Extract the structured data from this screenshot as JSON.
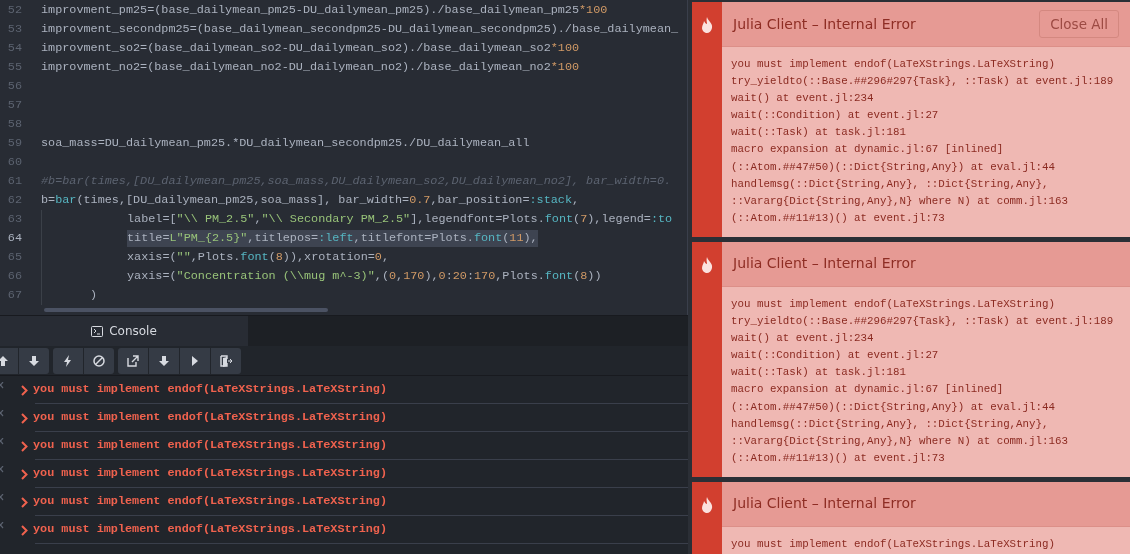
{
  "editor": {
    "lines": [
      {
        "number": "52",
        "tokens": [
          {
            "text": "improvment_pm25=(base_dailymean_pm25-DU_dailymean_pm25)./base_dailymean_pm25",
            "kind": "plain"
          },
          {
            "text": "*100",
            "kind": "number"
          }
        ]
      },
      {
        "number": "53",
        "tokens": [
          {
            "text": "improvment_secondpm25=(base_dailymean_secondpm25-DU_dailymean_secondpm25)./base_dailymean_",
            "kind": "plain"
          }
        ]
      },
      {
        "number": "54",
        "tokens": [
          {
            "text": "improvment_so2=(base_dailymean_so2-DU_dailymean_so2)./base_dailymean_so2",
            "kind": "plain"
          },
          {
            "text": "*100",
            "kind": "number"
          }
        ]
      },
      {
        "number": "55",
        "tokens": [
          {
            "text": "improvment_no2=(base_dailymean_no2-DU_dailymean_no2)./base_dailymean_no2",
            "kind": "plain"
          },
          {
            "text": "*100",
            "kind": "number"
          }
        ]
      },
      {
        "number": "56"
      },
      {
        "number": "57"
      },
      {
        "number": "58"
      },
      {
        "number": "59",
        "tokens": [
          {
            "text": "soa_mass=DU_dailymean_pm25.*DU_dailymean_secondpm25./DU_dailymean_all",
            "kind": "plain"
          }
        ]
      },
      {
        "number": "60"
      },
      {
        "number": "61",
        "tokens": [
          {
            "text": "#b=bar(times,[DU_dailymean_pm25,soa_mass,DU_dailymean_so2,DU_dailymean_no2], bar_width=0.",
            "kind": "comment"
          }
        ]
      },
      {
        "number": "62",
        "tokens": [
          {
            "text": "b=",
            "kind": "plain"
          },
          {
            "text": "bar",
            "kind": "function"
          },
          {
            "text": "(times,[DU_dailymean_pm25,soa_mass], bar_width=",
            "kind": "plain"
          },
          {
            "text": "0.7",
            "kind": "number"
          },
          {
            "text": ",bar_position=",
            "kind": "plain"
          },
          {
            "text": ":stack",
            "kind": "function"
          },
          {
            "text": ",",
            "kind": "plain"
          }
        ]
      },
      {
        "number": "63",
        "kind": "continuation",
        "tokens": [
          {
            "text": "label=[",
            "kind": "plain"
          },
          {
            "text": "\"\\\\ PM_2.5\"",
            "kind": "string"
          },
          {
            "text": ",",
            "kind": "plain"
          },
          {
            "text": "\"\\\\ Secondary PM_2.5\"",
            "kind": "string"
          },
          {
            "text": "],legendfont=Plots.",
            "kind": "plain"
          },
          {
            "text": "font",
            "kind": "function"
          },
          {
            "text": "(",
            "kind": "plain"
          },
          {
            "text": "7",
            "kind": "number"
          },
          {
            "text": "),legend=",
            "kind": "plain"
          },
          {
            "text": ":to",
            "kind": "function"
          }
        ]
      },
      {
        "number": "64",
        "kind": "continuation",
        "selected": true,
        "tokens": [
          {
            "text": "title=",
            "kind": "plain"
          },
          {
            "text": "L\"PM_{2.5}\"",
            "kind": "string"
          },
          {
            "text": ",titlepos=",
            "kind": "plain"
          },
          {
            "text": ":left",
            "kind": "function"
          },
          {
            "text": ",titlefont=Plots.",
            "kind": "plain"
          },
          {
            "text": "font",
            "kind": "function"
          },
          {
            "text": "(",
            "kind": "plain"
          },
          {
            "text": "11",
            "kind": "number"
          },
          {
            "text": "),",
            "kind": "plain"
          }
        ]
      },
      {
        "number": "65",
        "kind": "continuation",
        "tokens": [
          {
            "text": "xaxis=(",
            "kind": "plain"
          },
          {
            "text": "\"\"",
            "kind": "string"
          },
          {
            "text": ",Plots.",
            "kind": "plain"
          },
          {
            "text": "font",
            "kind": "function"
          },
          {
            "text": "(",
            "kind": "plain"
          },
          {
            "text": "8",
            "kind": "number"
          },
          {
            "text": ")),xrotation=",
            "kind": "plain"
          },
          {
            "text": "0",
            "kind": "number"
          },
          {
            "text": ",",
            "kind": "plain"
          }
        ]
      },
      {
        "number": "66",
        "kind": "continuation",
        "tokens": [
          {
            "text": "yaxis=(",
            "kind": "plain"
          },
          {
            "text": "\"Concentration (\\\\mug m^-3)\"",
            "kind": "string"
          },
          {
            "text": ",(",
            "kind": "plain"
          },
          {
            "text": "0",
            "kind": "number"
          },
          {
            "text": ",",
            "kind": "plain"
          },
          {
            "text": "170",
            "kind": "number"
          },
          {
            "text": "),",
            "kind": "plain"
          },
          {
            "text": "0",
            "kind": "number"
          },
          {
            "text": ":",
            "kind": "plain"
          },
          {
            "text": "20",
            "kind": "number"
          },
          {
            "text": ":",
            "kind": "plain"
          },
          {
            "text": "170",
            "kind": "number"
          },
          {
            "text": ",Plots.",
            "kind": "plain"
          },
          {
            "text": "font",
            "kind": "function"
          },
          {
            "text": "(",
            "kind": "plain"
          },
          {
            "text": "8",
            "kind": "number"
          },
          {
            "text": "))",
            "kind": "plain"
          }
        ]
      },
      {
        "number": "67",
        "kind": "closing",
        "tokens": [
          {
            "text": ")",
            "kind": "plain"
          }
        ]
      }
    ]
  },
  "console": {
    "tab": {
      "label": "Console",
      "selected": true
    },
    "messages": [
      {
        "text": "you must implement endof(LaTeXStrings.LaTeXString)"
      },
      {
        "text": "you must implement endof(LaTeXStrings.LaTeXString)"
      },
      {
        "text": "you must implement endof(LaTeXStrings.LaTeXString)"
      },
      {
        "text": "you must implement endof(LaTeXStrings.LaTeXString)"
      },
      {
        "text": "you must implement endof(LaTeXStrings.LaTeXString)"
      },
      {
        "text": "you must implement endof(LaTeXStrings.LaTeXString)"
      }
    ]
  },
  "notifications": [
    {
      "title": "Julia Client – Internal Error",
      "button": "Close All",
      "lines": [
        "you must implement endof(LaTeXStrings.LaTeXString)",
        "try_yieldto(::Base.##296#297{Task}, ::Task) at event.jl:189",
        "wait() at event.jl:234",
        "wait(::Condition) at event.jl:27",
        "wait(::Task) at task.jl:181",
        "macro expansion at dynamic.jl:67 [inlined]",
        "(::Atom.##47#50)(::Dict{String,Any}) at eval.jl:44",
        "handlemsg(::Dict{String,Any}, ::Dict{String,Any},",
        "::Vararg{Dict{String,Any},N} where N) at comm.jl:163",
        "(::Atom.##11#13)() at event.jl:73"
      ]
    },
    {
      "title": "Julia Client – Internal Error",
      "lines": [
        "you must implement endof(LaTeXStrings.LaTeXString)",
        "try_yieldto(::Base.##296#297{Task}, ::Task) at event.jl:189",
        "wait() at event.jl:234",
        "wait(::Condition) at event.jl:27",
        "wait(::Task) at task.jl:181",
        "macro expansion at dynamic.jl:67 [inlined]",
        "(::Atom.##47#50)(::Dict{String,Any}) at eval.jl:44",
        "handlemsg(::Dict{String,Any}, ::Dict{String,Any},",
        "::Vararg{Dict{String,Any},N} where N) at comm.jl:163",
        "(::Atom.##11#13)() at event.jl:73"
      ]
    },
    {
      "title": "Julia Client – Internal Error",
      "lines": [
        "you must implement endof(LaTeXStrings.LaTeXString)"
      ]
    }
  ]
}
